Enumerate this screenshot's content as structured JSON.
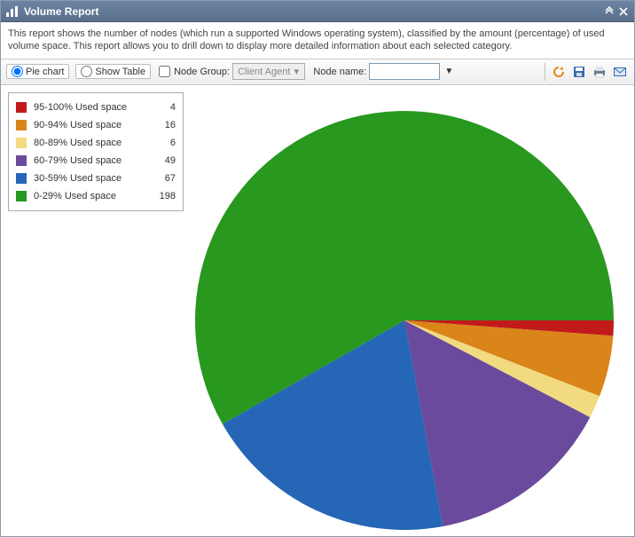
{
  "header": {
    "title": "Volume Report"
  },
  "description": "This report shows the number of nodes (which run a supported Windows operating system), classified by the amount (percentage) of used volume space. This report allows you to drill down to display more detailed information about each selected category.",
  "toolbar": {
    "view_pie_label": "Pie chart",
    "view_table_label": "Show Table",
    "node_group_label": "Node Group:",
    "node_group_selected": "Client Agent",
    "node_name_label": "Node name:",
    "node_name_value": ""
  },
  "legend": {
    "items": [
      {
        "label": "95-100% Used space",
        "value": 4,
        "color": "#c21a1a"
      },
      {
        "label": "90-94% Used space",
        "value": 16,
        "color": "#d98519"
      },
      {
        "label": "80-89% Used space",
        "value": 6,
        "color": "#f2da80"
      },
      {
        "label": "60-79% Used space",
        "value": 49,
        "color": "#6a4a9c"
      },
      {
        "label": "30-59% Used space",
        "value": 67,
        "color": "#2566b6"
      },
      {
        "label": "0-29% Used space",
        "value": 198,
        "color": "#28981f"
      }
    ]
  },
  "chart_data": {
    "type": "pie",
    "title": "Volume Report",
    "categories": [
      "95-100% Used space",
      "90-94% Used space",
      "80-89% Used space",
      "60-79% Used space",
      "30-59% Used space",
      "0-29% Used space"
    ],
    "values": [
      4,
      16,
      6,
      49,
      67,
      198
    ],
    "colors": [
      "#c21a1a",
      "#d98519",
      "#f2da80",
      "#6a4a9c",
      "#2566b6",
      "#28981f"
    ]
  }
}
